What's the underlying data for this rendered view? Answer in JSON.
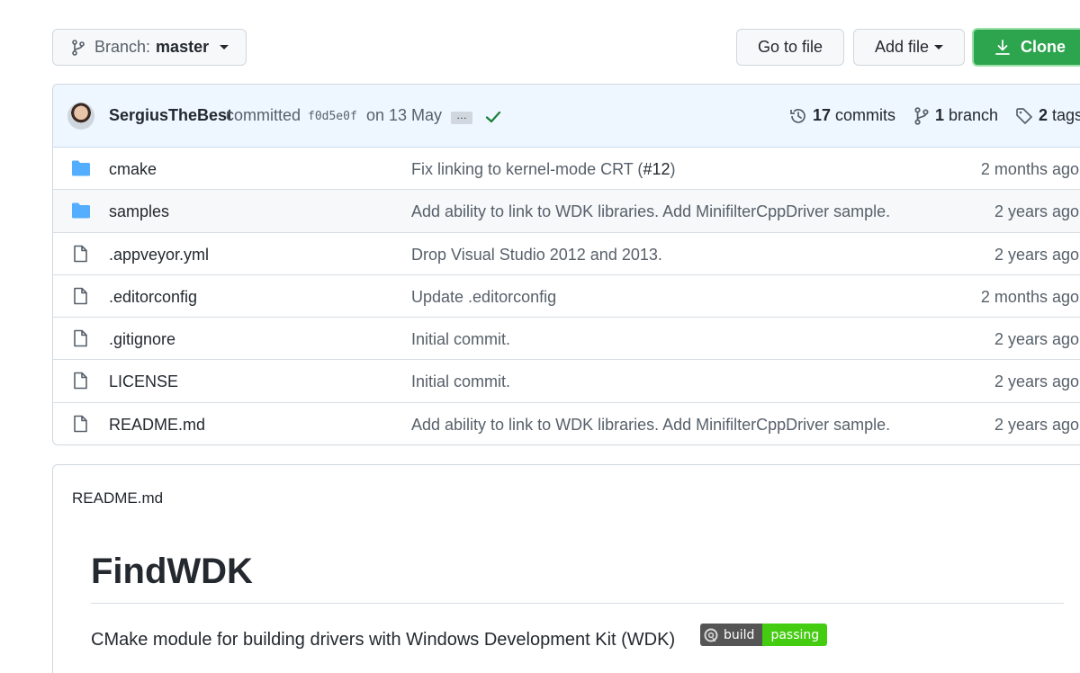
{
  "toolbar": {
    "branch_prefix": "Branch:",
    "branch_name": "master",
    "goto_file": "Go to file",
    "add_file": "Add file",
    "clone": "Clone"
  },
  "commit": {
    "author": "SergiusTheBest",
    "verb": "committed",
    "sha": "f0d5e0f",
    "date": "on 13 May",
    "ellipsis": "…",
    "status_icon": "check-icon"
  },
  "stats": {
    "commits_count": "17",
    "commits_label": "commits",
    "branch_count": "1",
    "branch_label": "branch",
    "tags_count": "2",
    "tags_label": "tags"
  },
  "files": [
    {
      "type": "folder",
      "name": "cmake",
      "message": "Fix linking to kernel-mode CRT (",
      "pr": "#12",
      "message_end": ")",
      "age": "2 months ago"
    },
    {
      "type": "folder",
      "name": "samples",
      "message": "Add ability to link to WDK libraries. Add MinifilterCppDriver sample.",
      "pr": "",
      "message_end": "",
      "age": "2 years ago"
    },
    {
      "type": "file",
      "name": ".appveyor.yml",
      "message": "Drop Visual Studio 2012 and 2013.",
      "pr": "",
      "message_end": "",
      "age": "2 years ago"
    },
    {
      "type": "file",
      "name": ".editorconfig",
      "message": "Update .editorconfig",
      "pr": "",
      "message_end": "",
      "age": "2 months ago"
    },
    {
      "type": "file",
      "name": ".gitignore",
      "message": "Initial commit.",
      "pr": "",
      "message_end": "",
      "age": "2 years ago"
    },
    {
      "type": "file",
      "name": "LICENSE",
      "message": "Initial commit.",
      "pr": "",
      "message_end": "",
      "age": "2 years ago"
    },
    {
      "type": "file",
      "name": "README.md",
      "message": "Add ability to link to WDK libraries. Add MinifilterCppDriver sample.",
      "pr": "",
      "message_end": "",
      "age": "2 years ago"
    }
  ],
  "readme": {
    "filename": "README.md",
    "title": "FindWDK",
    "description": "CMake module for building drivers with Windows Development Kit (WDK)",
    "badge_left": "build",
    "badge_right": "passing"
  },
  "colors": {
    "clone_green": "#2da44e",
    "folder_blue": "#54aeff",
    "check_green": "#1a7f37",
    "badge_green": "#44cc11"
  }
}
